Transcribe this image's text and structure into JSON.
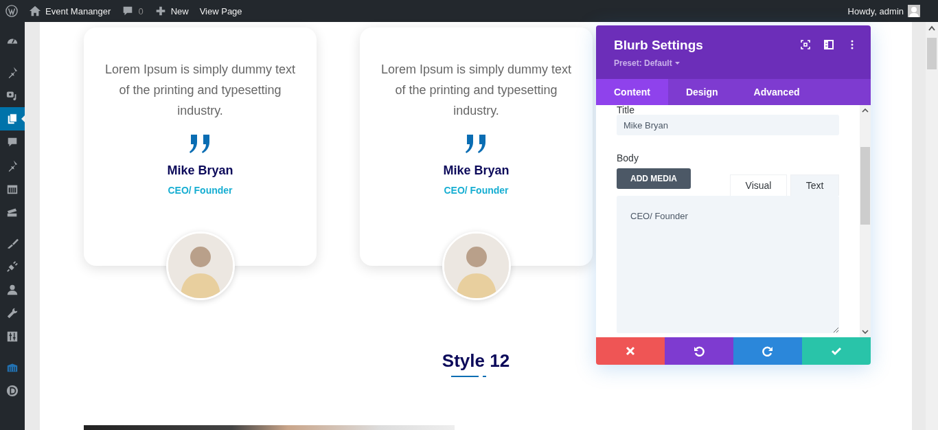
{
  "admin_bar": {
    "site_name": "Event Mananger",
    "comments_count": "0",
    "new_label": "New",
    "view_label": "View Page",
    "greeting": "Howdy, admin"
  },
  "sidebar": {
    "items": [
      {
        "selected": false
      },
      {
        "selected": false
      },
      {
        "selected": false
      },
      {
        "selected": true
      },
      {
        "selected": false
      },
      {
        "selected": false
      },
      {
        "selected": false
      },
      {
        "selected": false
      },
      {
        "selected": false
      },
      {
        "selected": false
      },
      {
        "selected": false
      },
      {
        "selected": false
      },
      {
        "selected": false
      },
      {
        "selected": false
      },
      {
        "selected": false
      }
    ]
  },
  "cards": [
    {
      "text": "Lorem Ipsum is simply dummy text of the printing and typesetting industry.",
      "name": "Mike Bryan",
      "role": "CEO/ Founder"
    },
    {
      "text": "Lorem Ipsum is simply dummy text of the printing and typesetting industry.",
      "name": "Mike Bryan",
      "role": "CEO/ Founder"
    }
  ],
  "section_heading": "Style 12",
  "settings_panel": {
    "title": "Blurb Settings",
    "preset": "Preset: Default",
    "tabs": [
      {
        "label": "Content",
        "selected": true
      },
      {
        "label": "Design",
        "selected": false
      },
      {
        "label": "Advanced",
        "selected": false
      }
    ],
    "title_label": "Title",
    "title_value": "Mike Bryan",
    "body_label": "Body",
    "add_media": "ADD MEDIA",
    "editor_tabs": [
      {
        "label": "Visual",
        "selected": false
      },
      {
        "label": "Text",
        "selected": true
      }
    ],
    "body_value": "CEO/ Founder"
  }
}
